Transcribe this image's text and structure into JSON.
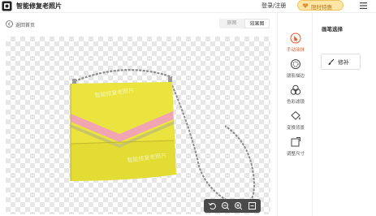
{
  "header": {
    "app_title": "智能修复老照片",
    "login_label": "登录/注册",
    "promo_label": "限时特惠",
    "menu_icon": "menu-icon"
  },
  "toolbar": {
    "back_label": "返回首页",
    "view_toggle": [
      "原图",
      "效果图"
    ],
    "selected_view": "效果图"
  },
  "canvas": {
    "watermark": "智能修复老照片",
    "zoom_controls": [
      "undo-icon",
      "zoom-out-icon",
      "zoom-in-icon",
      "fit-icon"
    ]
  },
  "sidebar": {
    "items": [
      {
        "label": "手动涂抹",
        "icon": "brush-cursor-icon",
        "active": true
      },
      {
        "label": "朋影描边",
        "icon": "outline-icon",
        "active": false
      },
      {
        "label": "色彩滤镜",
        "icon": "color-filter-icon",
        "active": false
      },
      {
        "label": "变换背景",
        "icon": "paint-bucket-icon",
        "active": false
      },
      {
        "label": "调整尺寸",
        "icon": "resize-icon",
        "active": false
      }
    ]
  },
  "panel": {
    "title": "画笔选择",
    "repair_label": "修补"
  },
  "colors": {
    "accent": "#e05a2b",
    "promo_bg": "#fde6a6",
    "bag_yellow": "#e6df3a",
    "stripe_pink": "#f2a6b4"
  }
}
